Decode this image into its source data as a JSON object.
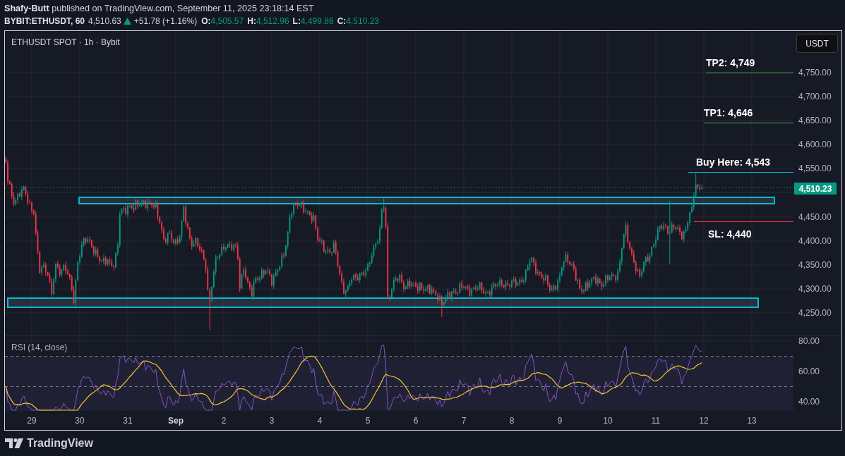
{
  "attribution": "**Shafy-Butt** published on TradingView.com, September 11, 2025 23:18:14 EST",
  "quote": {
    "symbol": "BYBIT:ETHUSDT, 60",
    "last": "4,510.63",
    "rising": true,
    "change": "+51.78 (+1.16%)",
    "ohlc": [
      {
        "label": "O:",
        "value": "4,505.57"
      },
      {
        "label": "H:",
        "value": "4,512.96"
      },
      {
        "label": "L:",
        "value": "4,499.86"
      },
      {
        "label": "C:",
        "value": "4,510.23"
      }
    ]
  },
  "chart": {
    "title": "ETHUSDT SPOT · 1h · Bybit",
    "currency_button": "USDT",
    "price_axis": [
      "4,750.00",
      "4,700.00",
      "4,650.00",
      "4,600.00",
      "4,550.00",
      "4,450.00",
      "4,400.00",
      "4,350.00",
      "4,300.00",
      "4,250.00"
    ],
    "last_price": "4,510.23",
    "levels": [
      {
        "kind": "target",
        "text": "TP2: 4,749",
        "color": "#4caf50"
      },
      {
        "kind": "target",
        "text": "TP1: 4,646",
        "color": "#4caf50"
      },
      {
        "kind": "entry",
        "text": "Buy Here: 4,543",
        "color": "#00bcd4"
      },
      {
        "kind": "stop",
        "text": "SL: 4,440",
        "color": "#f23645"
      }
    ]
  },
  "rsi": {
    "title": "RSI (14, close)",
    "axis": [
      "80.00",
      "60.00",
      "40.00"
    ]
  },
  "time_axis": [
    {
      "label": "29",
      "kind": "day"
    },
    {
      "label": "30",
      "kind": "day"
    },
    {
      "label": "31",
      "kind": "day"
    },
    {
      "label": "Sep",
      "kind": "month"
    },
    {
      "label": "2",
      "kind": "day"
    },
    {
      "label": "3",
      "kind": "day"
    },
    {
      "label": "4",
      "kind": "day"
    },
    {
      "label": "5",
      "kind": "day"
    },
    {
      "label": "6",
      "kind": "day"
    },
    {
      "label": "7",
      "kind": "day"
    },
    {
      "label": "8",
      "kind": "day"
    },
    {
      "label": "9",
      "kind": "day"
    },
    {
      "label": "10",
      "kind": "day"
    },
    {
      "label": "11",
      "kind": "day"
    },
    {
      "label": "12",
      "kind": "day"
    },
    {
      "label": "13",
      "kind": "day"
    }
  ],
  "footer": {
    "brand": "TradingView"
  }
}
